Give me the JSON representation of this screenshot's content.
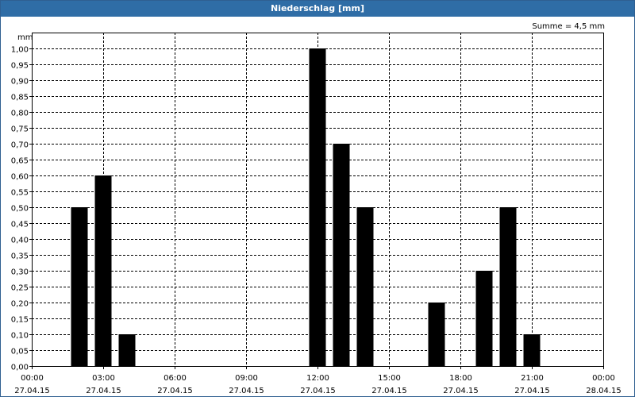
{
  "window": {
    "title": "Niederschlag [mm]"
  },
  "chart_data": {
    "type": "bar",
    "title": "Niederschlag [mm]",
    "ylabel": "mm",
    "summary": "Summe = 4,5 mm",
    "ylim": [
      0,
      1.05
    ],
    "xlim_hours": [
      0,
      24
    ],
    "y_ticks": [
      "0,00",
      "0,05",
      "0,10",
      "0,15",
      "0,20",
      "0,25",
      "0,30",
      "0,35",
      "0,40",
      "0,45",
      "0,50",
      "0,55",
      "0,60",
      "0,65",
      "0,70",
      "0,75",
      "0,80",
      "0,85",
      "0,90",
      "0,95",
      "1,00"
    ],
    "x_ticks": [
      {
        "time": "00:00",
        "date": "27.04.15"
      },
      {
        "time": "03:00",
        "date": "27.04.15"
      },
      {
        "time": "06:00",
        "date": "27.04.15"
      },
      {
        "time": "09:00",
        "date": "27.04.15"
      },
      {
        "time": "12:00",
        "date": "27.04.15"
      },
      {
        "time": "15:00",
        "date": "27.04.15"
      },
      {
        "time": "18:00",
        "date": "27.04.15"
      },
      {
        "time": "21:00",
        "date": "27.04.15"
      },
      {
        "time": "00:00",
        "date": "28.04.15"
      }
    ],
    "bars": [
      {
        "hour": 2,
        "value": 0.5
      },
      {
        "hour": 3,
        "value": 0.6
      },
      {
        "hour": 4,
        "value": 0.1
      },
      {
        "hour": 12,
        "value": 1.0
      },
      {
        "hour": 13,
        "value": 0.7
      },
      {
        "hour": 14,
        "value": 0.5
      },
      {
        "hour": 17,
        "value": 0.2
      },
      {
        "hour": 19,
        "value": 0.3
      },
      {
        "hour": 20,
        "value": 0.5
      },
      {
        "hour": 21,
        "value": 0.1
      }
    ],
    "bar_color": "#000000",
    "grid": true
  }
}
